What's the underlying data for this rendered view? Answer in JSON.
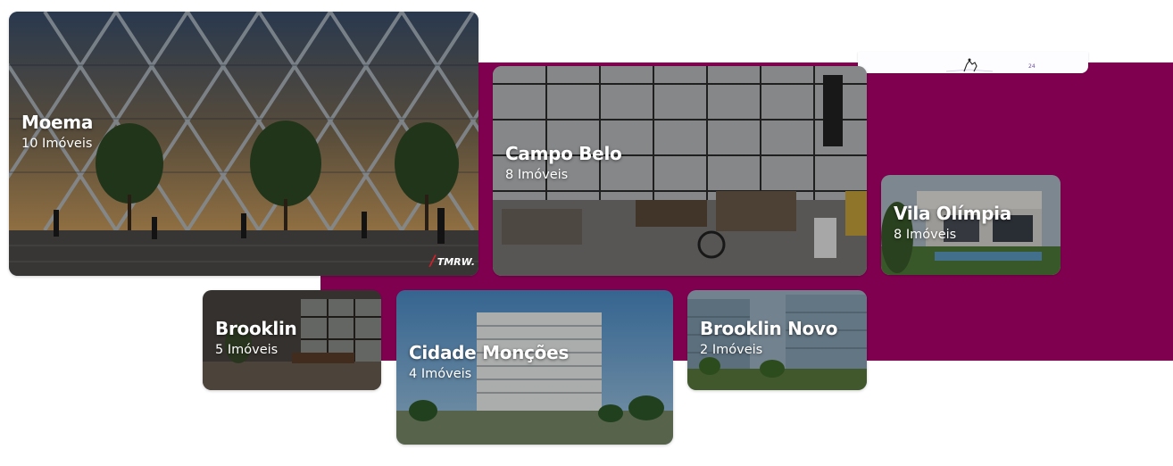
{
  "neighborhoods": [
    {
      "name": "Moema",
      "count": "10 Imóveis",
      "photo": "glass-diagrid-tower"
    },
    {
      "name": "Campo Belo",
      "count": "8 Imóveis",
      "photo": "industrial-loft-office"
    },
    {
      "name": "Vila Olímpia",
      "count": "8 Imóveis",
      "photo": "modern-house"
    },
    {
      "name": "Brooklin",
      "count": "5 Imóveis",
      "photo": "lobby-interior"
    },
    {
      "name": "Cidade Monções",
      "count": "4 Imóveis",
      "photo": "residential-tower"
    },
    {
      "name": "Brooklin Novo",
      "count": "2 Imóveis",
      "photo": "office-complex"
    }
  ],
  "moema_photo_brand": "TMRW.",
  "floating_tab": {
    "number": "24"
  },
  "colors": {
    "band": "#800050",
    "text": "#ffffff",
    "background": "#ffffff"
  }
}
